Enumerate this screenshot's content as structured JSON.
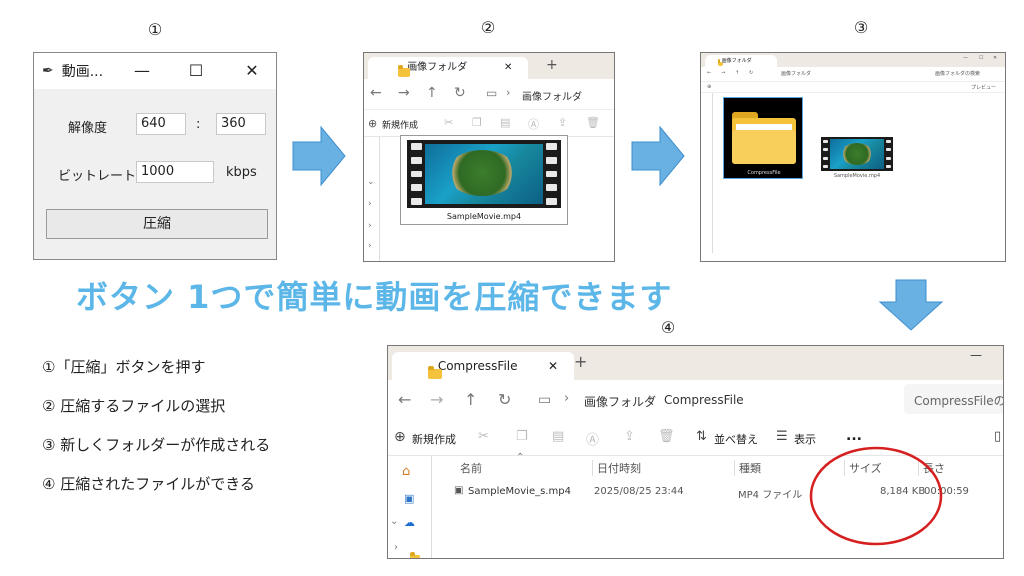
{
  "step_numbers": [
    "①",
    "②",
    "③",
    "④"
  ],
  "panel1": {
    "title": "動画...",
    "minimize": "—",
    "maximize": "☐",
    "close": "✕",
    "resolution_label": "解像度",
    "width_value": "640",
    "separator": ":",
    "height_value": "360",
    "bitrate_label": "ビットレート",
    "bitrate_value": "1000",
    "bitrate_unit": "kbps",
    "compress_button": "圧縮"
  },
  "panel2": {
    "tab_title": "画像フォルダ",
    "tab_close": "✕",
    "new_tab": "+",
    "breadcrumb": "画像フォルダ",
    "new_button": "新規作成",
    "file_name": "SampleMovie.mp4"
  },
  "panel3": {
    "tab_title": "画像フォルダ",
    "breadcrumb": "画像フォルダ",
    "search_placeholder": "画像フォルダの検索",
    "folder_name": "CompressFile",
    "file_name": "SampleMovie.mp4",
    "preview": "プレビュー"
  },
  "banner": "ボタン 1つで簡単に動画を圧縮できます",
  "steps": [
    "①「圧縮」ボタンを押す",
    "② 圧縮するファイルの選択",
    "③ 新しくフォルダーが作成される",
    "④ 圧縮されたファイルができる"
  ],
  "panel4": {
    "tab_title": "CompressFile",
    "tab_close": "✕",
    "new_tab": "+",
    "minimize": "—",
    "breadcrumb_parent": "画像フォルダ",
    "breadcrumb_current": "CompressFile",
    "search_placeholder": "CompressFileの検索",
    "new_button": "新規作成",
    "sort_button": "並べ替え",
    "view_button": "表示",
    "more": "...",
    "columns": [
      "名前",
      "日付時刻",
      "種類",
      "サイズ",
      "長さ"
    ],
    "row": {
      "name": "SampleMovie_s.mp4",
      "date": "2025/08/25 23:44",
      "type": "MP4 ファイル",
      "size": "8,184 KB",
      "length": "00:00:59"
    }
  },
  "colors": {
    "banner": "#5cb7e8",
    "arrow": "#69b0e3",
    "highlight_circle": "#d61f1f",
    "folder": "#f5c33b"
  }
}
